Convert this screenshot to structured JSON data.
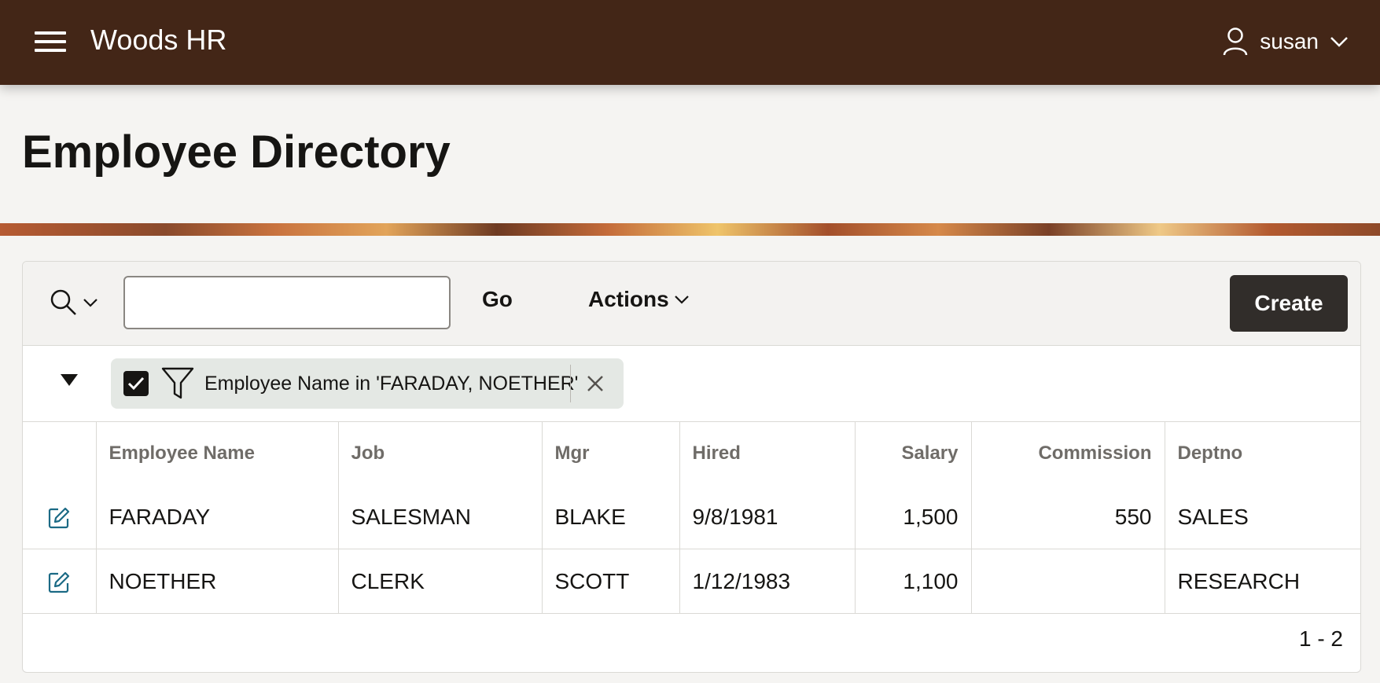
{
  "app": {
    "title": "Woods HR"
  },
  "user": {
    "name": "susan"
  },
  "page": {
    "title": "Employee Directory"
  },
  "toolbar": {
    "search_placeholder": "",
    "search_value": "",
    "go_label": "Go",
    "actions_label": "Actions",
    "create_label": "Create"
  },
  "filter": {
    "text": "Employee Name in 'FARADAY, NOETHER'",
    "enabled": true
  },
  "table": {
    "columns": [
      "Employee Name",
      "Job",
      "Mgr",
      "Hired",
      "Salary",
      "Commission",
      "Deptno"
    ],
    "rows": [
      [
        "FARADAY",
        "SALESMAN",
        "BLAKE",
        "9/8/1981",
        "1,500",
        "550",
        "SALES"
      ],
      [
        "NOETHER",
        "CLERK",
        "SCOTT",
        "1/12/1983",
        "1,100",
        "",
        "RESEARCH"
      ]
    ]
  },
  "pagination": {
    "range": "1 - 2"
  },
  "colors": {
    "header_bg": "#432617",
    "create_button_bg": "#312d2a",
    "edit_icon": "#1b6a85",
    "filter_chip_bg": "#e4e8e4"
  },
  "icons": [
    "hamburger-icon",
    "user-icon",
    "chevron-down-icon",
    "search-icon",
    "funnel-icon",
    "close-icon",
    "edit-icon",
    "check-icon"
  ]
}
